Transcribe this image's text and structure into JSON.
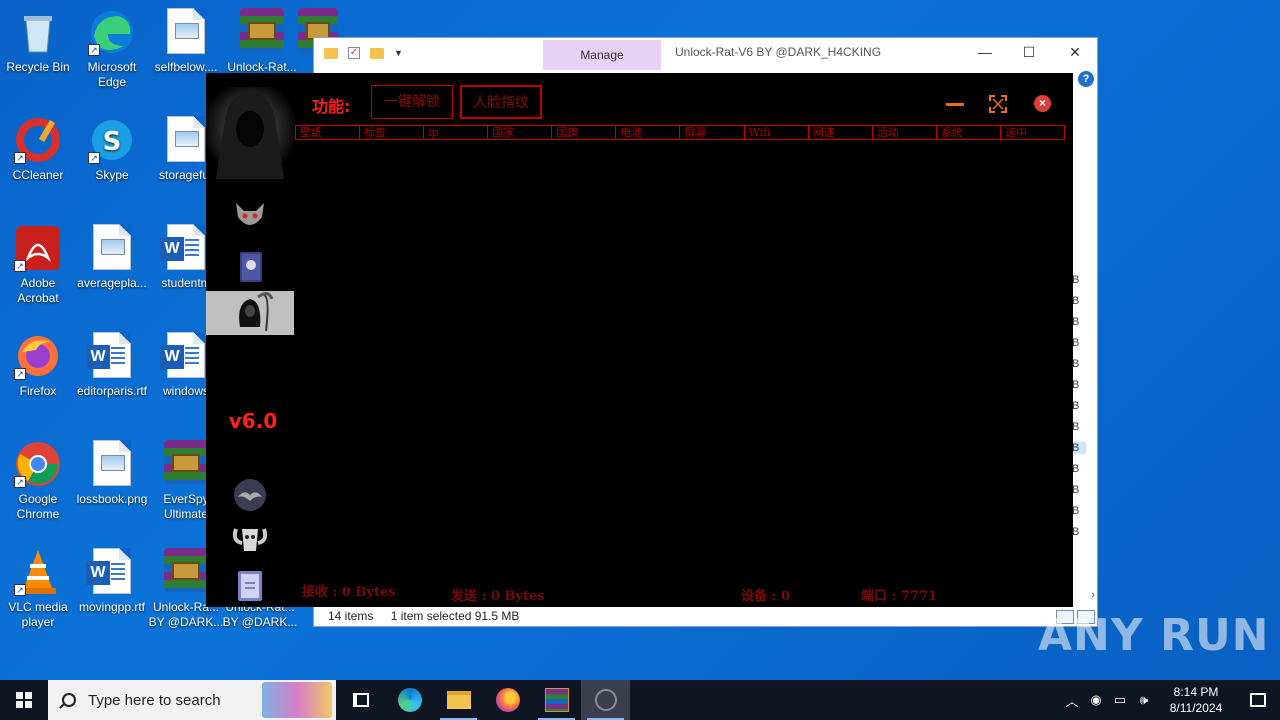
{
  "desktop": {
    "icons": [
      {
        "label": "Recycle Bin"
      },
      {
        "label": "Microsoft Edge"
      },
      {
        "label": "selfbelow...."
      },
      {
        "label": "Unlock-Rat..."
      },
      {
        "label": "U"
      },
      {
        "label": "CCleaner"
      },
      {
        "label": "Skype"
      },
      {
        "label": "storagefur"
      },
      {
        "label": "Adobe Acrobat"
      },
      {
        "label": "averagepla..."
      },
      {
        "label": "studentm"
      },
      {
        "label": "Firefox"
      },
      {
        "label": "editorparis.rtf"
      },
      {
        "label": "windows"
      },
      {
        "label": "Google Chrome"
      },
      {
        "label": "lossbook.png"
      },
      {
        "label": "EverSpy Ultimate"
      },
      {
        "label": "VLC media player"
      },
      {
        "label": "movingpp.rtf"
      },
      {
        "label": "Unlock-Ra... BY @DARK..."
      },
      {
        "label": "Unlock-Rat... BY @DARK..."
      }
    ]
  },
  "explorer": {
    "manage_tab": "Manage",
    "title": "Unlock-Rat-V6 BY @DARK_H4CKING",
    "status_items": "14 items",
    "status_selected": "1 item selected  91.5 MB",
    "size_suffix": "B"
  },
  "rat_window": {
    "func_label": "功能:",
    "buttons": [
      "一键解锁",
      "人脸指纹"
    ],
    "columns": [
      "壁纸",
      "标签",
      "ip",
      "国家",
      "国旗",
      "电池",
      "屏幕",
      "Wifi",
      "网速",
      "活动",
      "系统",
      "选中"
    ],
    "version": "v6.0",
    "status": {
      "recv": "接收 : 0 Bytes",
      "send": "发送 : 0 Bytes",
      "devices": "设备 : 0",
      "port": "端口 : 7771"
    }
  },
  "taskbar": {
    "search_placeholder": "Type here to search",
    "time": "8:14 PM",
    "date": "8/11/2024"
  },
  "watermark": "ANY RUN"
}
